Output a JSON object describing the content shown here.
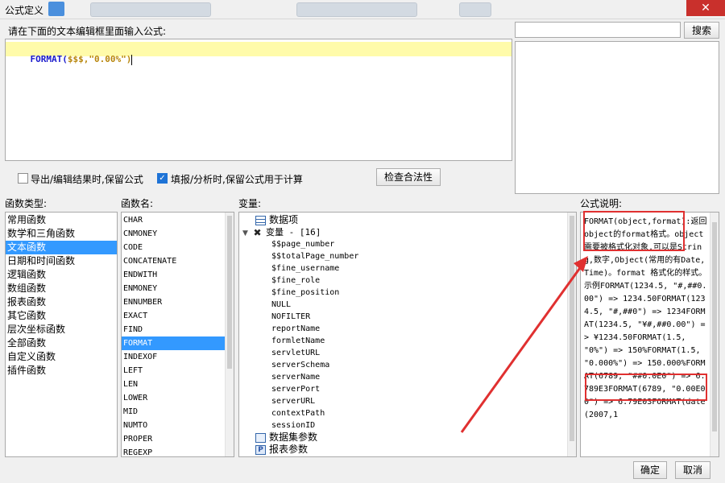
{
  "window": {
    "title": "公式定义",
    "close_glyph": "✕"
  },
  "editor": {
    "instruction": "请在下面的文本编辑框里面输入公式:",
    "formula_func": "FORMAT(",
    "formula_args": "$$$,\"0.00%\")"
  },
  "search": {
    "value": "",
    "button_label": "搜索"
  },
  "options": {
    "export_keep_formula": {
      "label": "导出/编辑结果时,保留公式",
      "checked": false
    },
    "fill_keep_formula": {
      "label": "填报/分析时,保留公式用于计算",
      "checked": true
    },
    "check_button": "检查合法性"
  },
  "function_types": {
    "header": "函数类型:",
    "items": [
      "常用函数",
      "数学和三角函数",
      "文本函数",
      "日期和时间函数",
      "逻辑函数",
      "数组函数",
      "报表函数",
      "其它函数",
      "层次坐标函数",
      "全部函数",
      "自定义函数",
      "插件函数"
    ],
    "selected_index": 2
  },
  "function_names": {
    "header": "函数名:",
    "items": [
      "CHAR",
      "CNMONEY",
      "CODE",
      "CONCATENATE",
      "ENDWITH",
      "ENMONEY",
      "ENNUMBER",
      "EXACT",
      "FIND",
      "FORMAT",
      "INDEXOF",
      "LEFT",
      "LEN",
      "LOWER",
      "MID",
      "NUMTO",
      "PROPER",
      "REGEXP"
    ],
    "selected_index": 9
  },
  "variables": {
    "header": "变量:",
    "data_items": "数据项",
    "group_label": "变量 - [16]",
    "items": [
      "$$page_number",
      "$$totalPage_number",
      "$fine_username",
      "$fine_role",
      "$fine_position",
      "NULL",
      "NOFILTER",
      "reportName",
      "formletName",
      "servletURL",
      "serverSchema",
      "serverName",
      "serverPort",
      "serverURL",
      "contextPath",
      "sessionID"
    ],
    "dataset_params": "数据集参数",
    "report_params": "报表参数"
  },
  "description": {
    "header": "公式说明:",
    "text": "FORMAT(object,format):返回object的format格式。object 需要被格式化对象,可以是String,数字,Object(常用的有Date, Time)。format 格式化的样式。示例FORMAT(1234.5, \"#,##0.00\") => 1234.50FORMAT(1234.5, \"#,##0\") => 1234FORMAT(1234.5, \"¥#,##0.00\") => ¥1234.50FORMAT(1.5, \"0%\") => 150%FORMAT(1.5, \"0.000%\") => 150.000%FORMAT(6789, \"##0.0E0\") => 6.789E3FORMAT(6789, \"0.00E00\") => 6.79E03FORMAT(date(2007,1"
  },
  "footer": {
    "ok": "确定",
    "cancel": "取消"
  }
}
